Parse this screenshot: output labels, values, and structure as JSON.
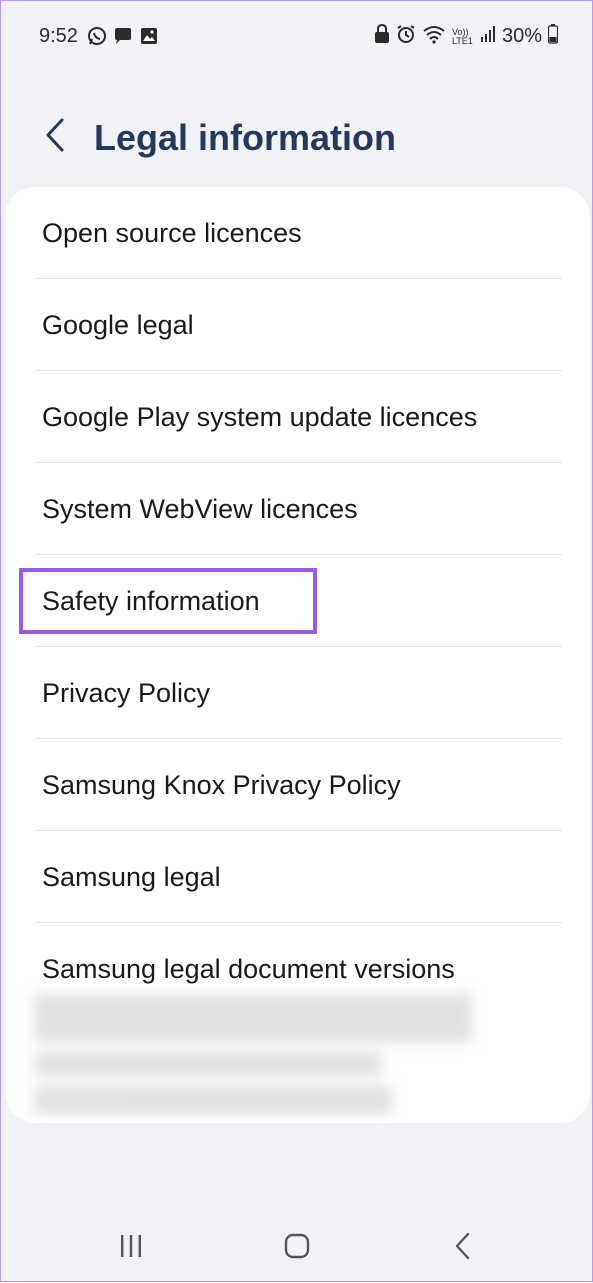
{
  "status_bar": {
    "time": "9:52",
    "left_icons": [
      "whatsapp-icon",
      "chat-icon",
      "gallery-icon"
    ],
    "right_icons": [
      "lock-icon",
      "alarm-icon",
      "wifi-icon",
      "volte-icon",
      "signal-icon"
    ],
    "volte_label": "Vo)) LTE1",
    "battery_percent": "30%"
  },
  "header": {
    "title": "Legal information",
    "back_icon": "chevron-left-icon"
  },
  "list": {
    "items": [
      {
        "label": "Open source licences"
      },
      {
        "label": "Google legal"
      },
      {
        "label": "Google Play system update licences"
      },
      {
        "label": "System WebView licences"
      },
      {
        "label": "Safety information",
        "highlighted": true
      },
      {
        "label": "Privacy Policy"
      },
      {
        "label": "Samsung Knox Privacy Policy"
      },
      {
        "label": "Samsung legal"
      },
      {
        "label": "Samsung legal document versions"
      }
    ]
  },
  "colors": {
    "background": "#f2f2f6",
    "card": "#ffffff",
    "title": "#243a5a",
    "highlight": "#9a5be6",
    "divider": "#e3e3e6"
  },
  "nav_bar": {
    "icons": [
      "recent-apps-icon",
      "home-icon",
      "back-icon"
    ]
  }
}
